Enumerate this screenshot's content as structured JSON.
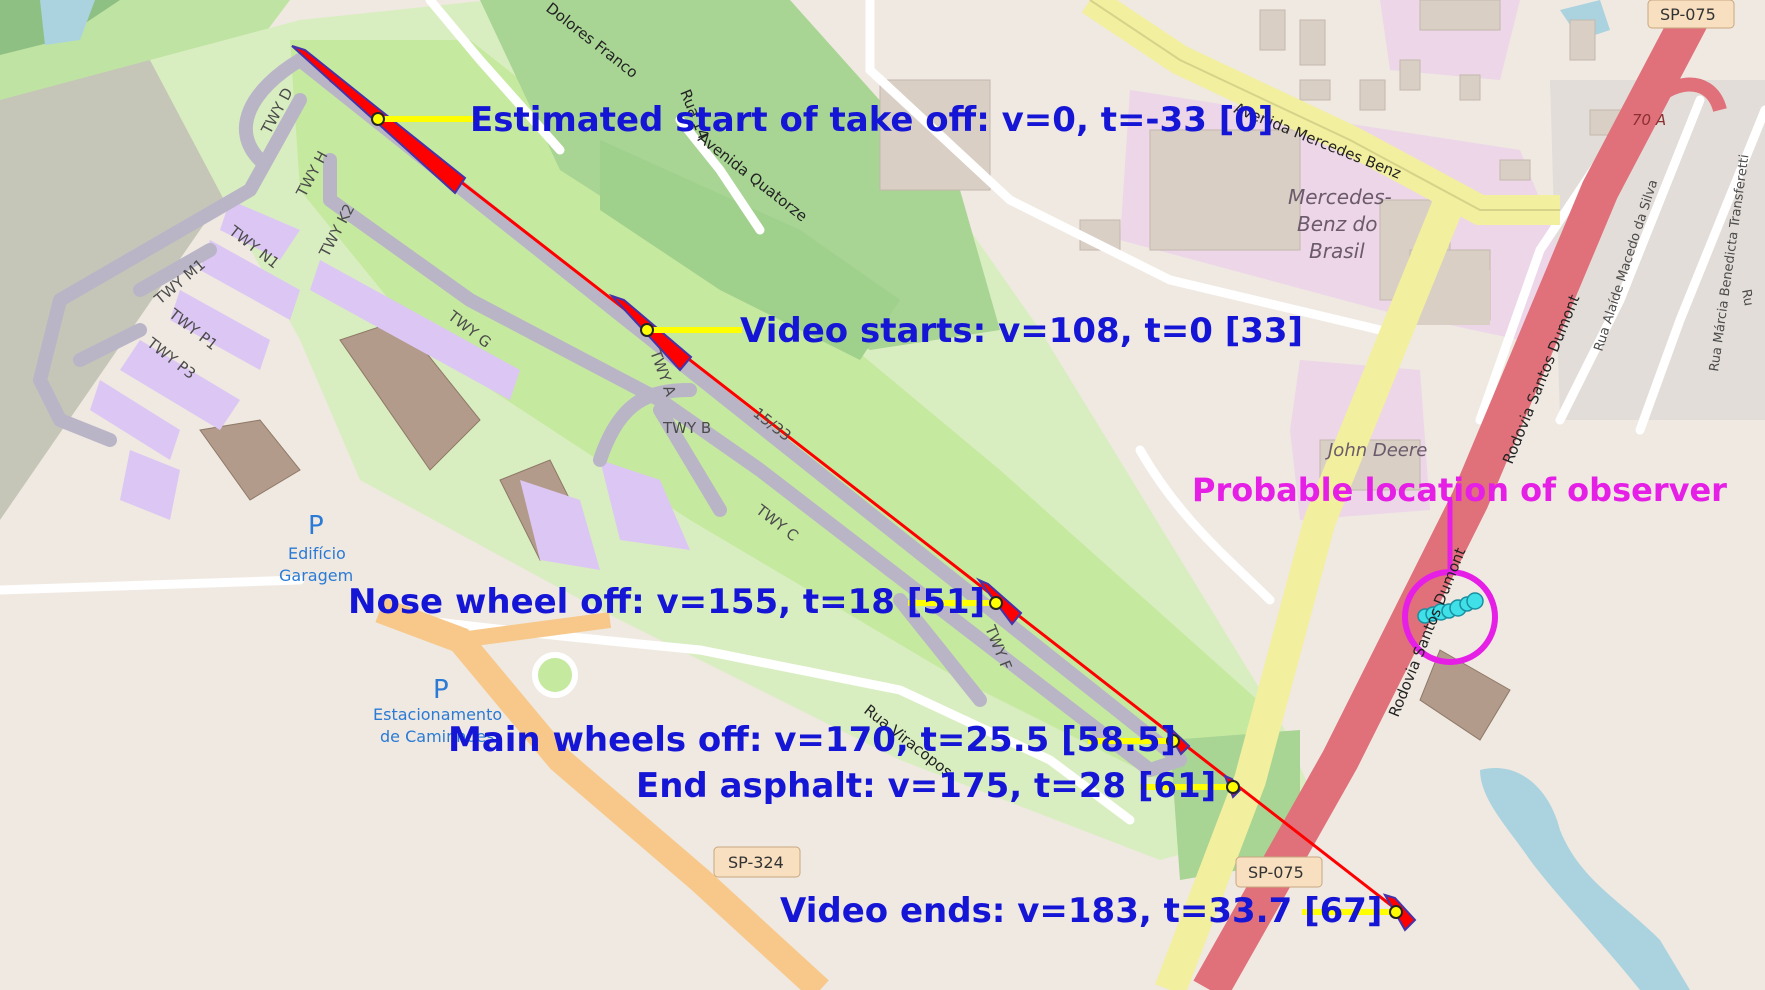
{
  "colors": {
    "runway_marker": "#ff0000",
    "leader_line": "#ffff00",
    "annotation_text": "#1515d6",
    "observer_circle": "#e61fe6",
    "observer_points": "#3fe0e8",
    "motorway": "#e0707a",
    "trunk": "#f2ef9e",
    "grass": "#c6e9a0",
    "forest": "#a8d494",
    "apron": "#dcc6f4",
    "building": "#b39b8b"
  },
  "annotations": {
    "start": "Estimated start of take off: v=0, t=-33 [0]",
    "video_start": "Video starts: v=108, t=0 [33]",
    "nose_off": "Nose wheel off: v=155, t=18 [51]",
    "main_off": "Main wheels off: v=170, t=25.5 [58.5]",
    "end_asphalt": "End asphalt: v=175, t=28 [61]",
    "video_end": "Video ends: v=183, t=33.7 [67]",
    "observer": "Probable location of observer"
  },
  "map_labels": {
    "twy_d": "TWY D",
    "twy_h": "TWY H",
    "twy_k2": "TWY K2",
    "twy_n1": "TWY N1",
    "twy_m1": "TWY M1",
    "twy_p1": "TWY P1",
    "twy_p3": "TWY P3",
    "twy_g": "TWY G",
    "twy_a": "TWY A",
    "twy_b": "TWY B",
    "twy_c": "TWY C",
    "twy_f": "TWY F",
    "runway": "15/33",
    "rua_dolores": "Dolores Franco",
    "rua_14": "Rua 14",
    "av_quatorze": "Avenida Quatorze",
    "av_mercedes": "Avenida Mercedes Benz",
    "mercedes_1": "Mercedes-",
    "mercedes_2": "Benz do",
    "mercedes_3": "Brasil",
    "john_deere": "John Deere",
    "rodovia_1": "Rodovia Santos Dumont",
    "rodovia_2": "Rodovia Santos Dumont",
    "rua_alaide": "Rua Alaíde Macedo da Silva",
    "rua_marcia": "Rua Márcia Benedicta Transferetti",
    "rua_r": "Ru",
    "edificio_1": "Edifício",
    "edificio_2": "Garagem",
    "estac_1": "Estacionamento",
    "estac_2": "de Caminhões",
    "rua_viracopos": "Rua Viracopos",
    "sp324": "SP-324",
    "sp075_top": "SP-075",
    "sp075_bottom": "SP-075",
    "exit_70a": "70 A",
    "p1": "P",
    "p2": "P"
  }
}
